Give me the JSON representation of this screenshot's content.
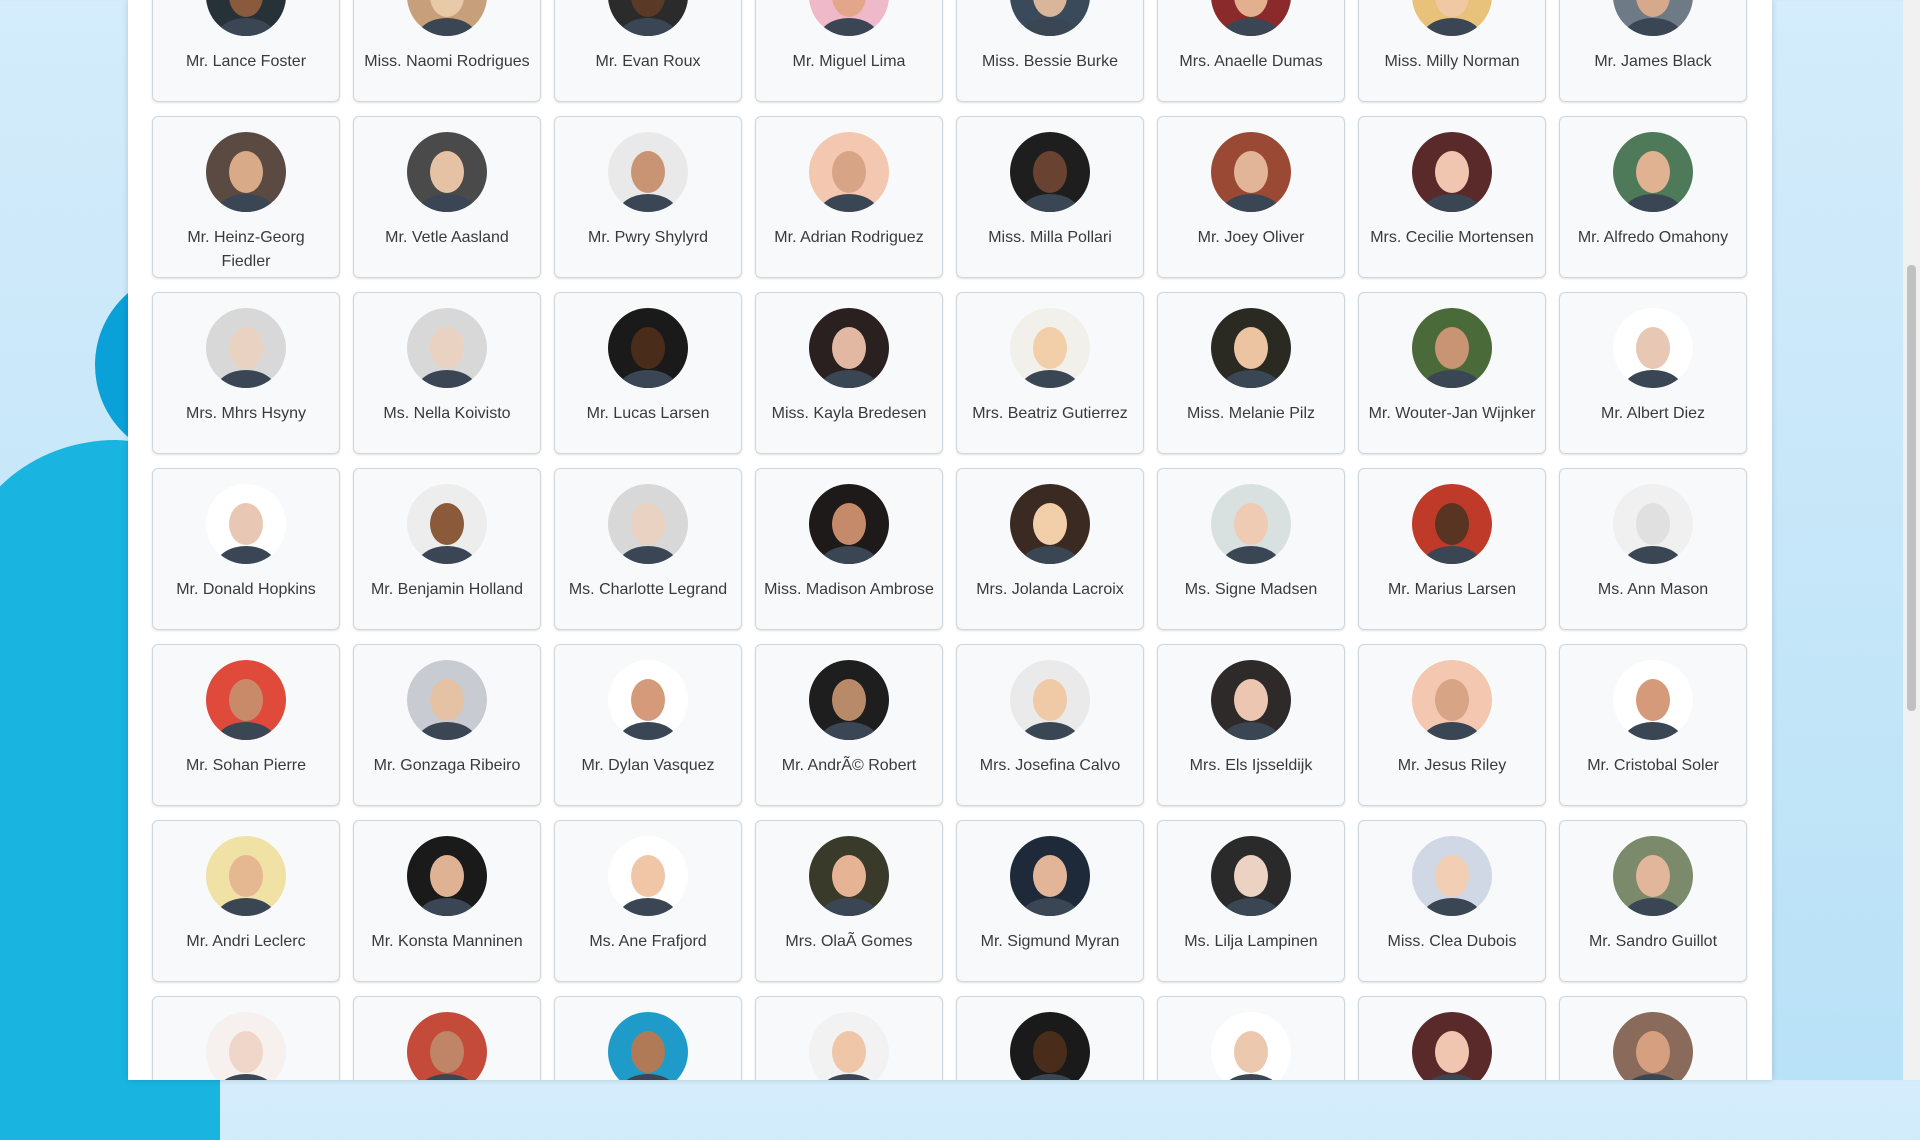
{
  "accent": "#19b4e0",
  "people": [
    {
      "name": "Mr. Lance Foster",
      "skin": "#8a5a3c",
      "bg": "#263238"
    },
    {
      "name": "Miss. Naomi Rodrigues",
      "skin": "#e8c9a8",
      "bg": "#c7a07b"
    },
    {
      "name": "Mr. Evan Roux",
      "skin": "#5a3a26",
      "bg": "#2b2b2b"
    },
    {
      "name": "Mr. Miguel Lima",
      "skin": "#e3a68a",
      "bg": "#f0b9c9"
    },
    {
      "name": "Miss. Bessie Burke",
      "skin": "#d9b59a",
      "bg": "#3a4a5a"
    },
    {
      "name": "Mrs. Anaelle Dumas",
      "skin": "#e2b08f",
      "bg": "#8a2a2a"
    },
    {
      "name": "Miss. Milly Norman",
      "skin": "#f0c8a4",
      "bg": "#e8c27a"
    },
    {
      "name": "Mr. James Black",
      "skin": "#d6a98a",
      "bg": "#6e7b87"
    },
    {
      "name": "Mr. Heinz-Georg Fiedler",
      "skin": "#d8aa88",
      "bg": "#5a4a42"
    },
    {
      "name": "Mr. Vetle Aasland",
      "skin": "#e6c2a4",
      "bg": "#4a4a4a"
    },
    {
      "name": "Mr. Pwry Shylyrd",
      "skin": "#c99474",
      "bg": "#e9e9e9"
    },
    {
      "name": "Mr. Adrian Rodriguez",
      "skin": "#d8a486",
      "bg": "#f3c7b0"
    },
    {
      "name": "Miss. Milla Pollari",
      "skin": "#6a4232",
      "bg": "#1e1e1e"
    },
    {
      "name": "Mr. Joey Oliver",
      "skin": "#e2b498",
      "bg": "#9a4a34"
    },
    {
      "name": "Mrs. Cecilie Mortensen",
      "skin": "#f1c6b0",
      "bg": "#5a2a2a"
    },
    {
      "name": "Mr. Alfredo Omahony",
      "skin": "#e0b292",
      "bg": "#4f7a5a"
    },
    {
      "name": "Mrs. Mhrs Hsyny",
      "skin": "#ead2c2",
      "bg": "#d8d8d8"
    },
    {
      "name": "Ms. Nella Koivisto",
      "skin": "#ead2c2",
      "bg": "#d8d8d8"
    },
    {
      "name": "Mr. Lucas Larsen",
      "skin": "#4a2c1a",
      "bg": "#1a1a1a"
    },
    {
      "name": "Miss. Kayla Bredesen",
      "skin": "#e2b8a2",
      "bg": "#2a2020"
    },
    {
      "name": "Mrs. Beatriz Gutierrez",
      "skin": "#f2cfa8",
      "bg": "#f2f0ea"
    },
    {
      "name": "Miss. Melanie Pilz",
      "skin": "#ecc4a2",
      "bg": "#2a2a22"
    },
    {
      "name": "Mr. Wouter-Jan Wijnker",
      "skin": "#c99474",
      "bg": "#4a6a3a"
    },
    {
      "name": "Mr. Albert Diez",
      "skin": "#e8c8b4",
      "bg": "#ffffff"
    },
    {
      "name": "Mr. Donald Hopkins",
      "skin": "#e8c8b4",
      "bg": "#ffffff"
    },
    {
      "name": "Mr. Benjamin Holland",
      "skin": "#8a5a3a",
      "bg": "#ededed"
    },
    {
      "name": "Ms. Charlotte Legrand",
      "skin": "#ead2c2",
      "bg": "#d8d8d8"
    },
    {
      "name": "Miss. Madison Ambrose",
      "skin": "#c48a6a",
      "bg": "#1e1a1a"
    },
    {
      "name": "Mrs. Jolanda Lacroix",
      "skin": "#f2cfa8",
      "bg": "#3a2a22"
    },
    {
      "name": "Ms. Signe Madsen",
      "skin": "#efcbb4",
      "bg": "#d8e0e0"
    },
    {
      "name": "Mr. Marius Larsen",
      "skin": "#5a3422",
      "bg": "#c03a2a"
    },
    {
      "name": "Ms. Ann Mason",
      "skin": "#e0e0e0",
      "bg": "#f0f0f0"
    },
    {
      "name": "Mr. Sohan Pierre",
      "skin": "#c98a6a",
      "bg": "#e04a3a"
    },
    {
      "name": "Mr. Gonzaga Ribeiro",
      "skin": "#e6c2a4",
      "bg": "#c8ccd2"
    },
    {
      "name": "Mr. Dylan Vasquez",
      "skin": "#d49a7a",
      "bg": "#ffffff"
    },
    {
      "name": "Mr. AndrÃ© Robert",
      "skin": "#b88a6a",
      "bg": "#1e1e1e"
    },
    {
      "name": "Mrs. Josefina Calvo",
      "skin": "#f0caa6",
      "bg": "#eaeaea"
    },
    {
      "name": "Mrs. Els Ijsseldijk",
      "skin": "#ecc6b0",
      "bg": "#2e2a2a"
    },
    {
      "name": "Mr. Jesus Riley",
      "skin": "#d8a486",
      "bg": "#f3c7b0"
    },
    {
      "name": "Mr. Cristobal Soler",
      "skin": "#d49a7a",
      "bg": "#ffffff"
    },
    {
      "name": "Mr. Andri Leclerc",
      "skin": "#e6b892",
      "bg": "#f0e2a4"
    },
    {
      "name": "Mr. Konsta Manninen",
      "skin": "#e0b294",
      "bg": "#1a1a1a"
    },
    {
      "name": "Ms. Ane Frafjord",
      "skin": "#f0c6a6",
      "bg": "#ffffff"
    },
    {
      "name": "Mrs. OlaÃ Gomes",
      "skin": "#e6b494",
      "bg": "#3a3a2a"
    },
    {
      "name": "Mr. Sigmund Myran",
      "skin": "#e2b498",
      "bg": "#1e2a3a"
    },
    {
      "name": "Ms. Lilja Lampinen",
      "skin": "#ecd2c2",
      "bg": "#2a2a2a"
    },
    {
      "name": "Miss. Clea Dubois",
      "skin": "#f2ceb4",
      "bg": "#cfd8e4"
    },
    {
      "name": "Mr. Sandro Guillot",
      "skin": "#e2b69a",
      "bg": "#7a8a6a"
    },
    {
      "name": "",
      "skin": "#f0d6c8",
      "bg": "#f6f0ee"
    },
    {
      "name": "",
      "skin": "#c08466",
      "bg": "#c44a3a"
    },
    {
      "name": "",
      "skin": "#b07a56",
      "bg": "#1e9bc8"
    },
    {
      "name": "",
      "skin": "#f0c6a8",
      "bg": "#f2f2f2"
    },
    {
      "name": "",
      "skin": "#4a2c1a",
      "bg": "#1a1a1a"
    },
    {
      "name": "",
      "skin": "#ecc8ae",
      "bg": "#ffffff"
    },
    {
      "name": "",
      "skin": "#f1c6b0",
      "bg": "#5a2a2a"
    },
    {
      "name": "",
      "skin": "#d6a080",
      "bg": "#8a6a5a"
    }
  ]
}
